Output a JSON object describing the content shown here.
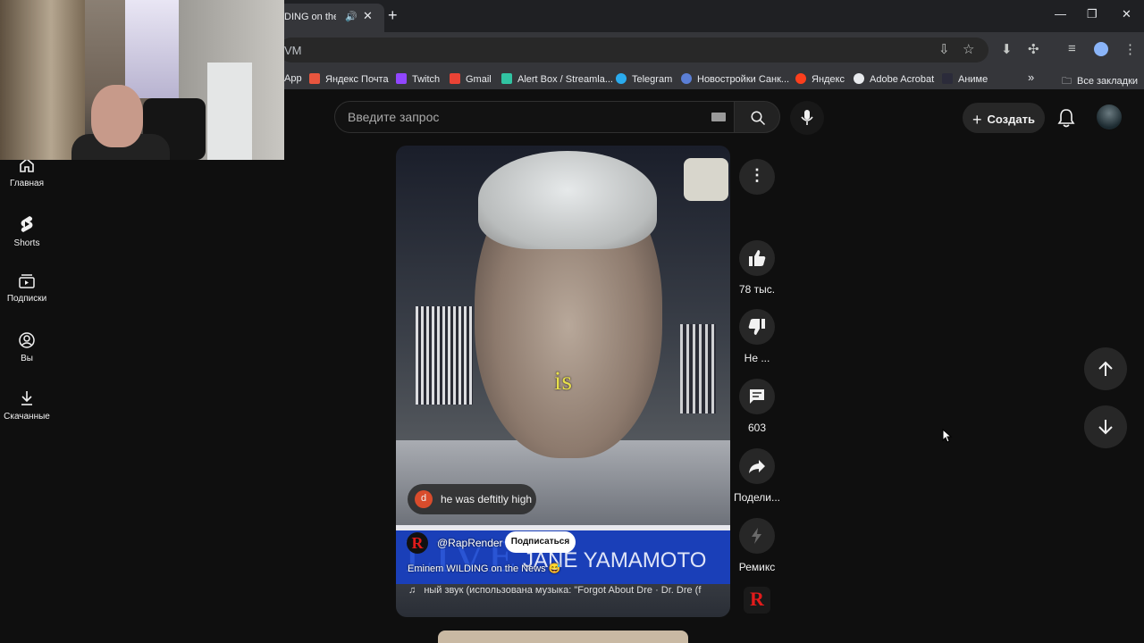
{
  "browser": {
    "tab_title": "DING on the N",
    "omnibox_text": "VM",
    "bookmarks": [
      {
        "label": "App",
        "color": "#8ab4f8"
      },
      {
        "label": "Яндекс Почта",
        "color": "#e8553e"
      },
      {
        "label": "Twitch",
        "color": "#9146ff"
      },
      {
        "label": "Gmail",
        "color": "#ea4335"
      },
      {
        "label": "Alert Box / Streamla...",
        "color": "#31c3a2"
      },
      {
        "label": "Telegram",
        "color": "#2aabee"
      },
      {
        "label": "Новостройки Санк...",
        "color": "#5b7fd6"
      },
      {
        "label": "Яндекс",
        "color": "#fc3f1d"
      },
      {
        "label": "Adobe Acrobat",
        "color": "#e8eaed"
      },
      {
        "label": "Аниме",
        "color": "#2b2b3a"
      }
    ],
    "all_bookmarks": "Все закладки"
  },
  "youtube": {
    "search_placeholder": "Введите запрос",
    "create_label": "Создать",
    "sidebar": [
      {
        "label": "Главная",
        "icon": "home-icon"
      },
      {
        "label": "Shorts",
        "icon": "shorts-icon"
      },
      {
        "label": "Подписки",
        "icon": "subscriptions-icon"
      },
      {
        "label": "Вы",
        "icon": "you-icon"
      },
      {
        "label": "Скачанные",
        "icon": "downloads-icon"
      }
    ],
    "short": {
      "caption_word": "is",
      "comment_avatar": "d",
      "comment_text": "he was deftitly high",
      "banner_live": "LIVE",
      "banner_name": "JANE YAMAMOTO",
      "channel_logo": "R",
      "channel": "@RapRender",
      "subscribe": "Подписаться",
      "title": "Eminem WILDING on the News 😅",
      "music_note": "♫",
      "music": "ный звук (использована музыка: \"Forgot About Dre · Dr. Dre (f"
    },
    "actions": {
      "likes": "78 тыс.",
      "dislike": "Не ...",
      "comments": "603",
      "share": "Подели...",
      "remix": "Ремикс",
      "remix_logo": "R"
    }
  }
}
